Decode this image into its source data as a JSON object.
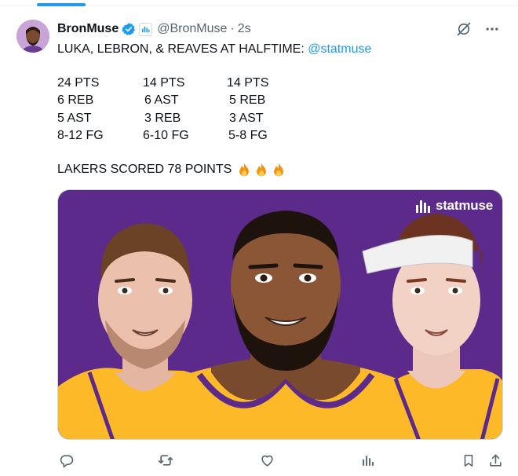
{
  "tweet": {
    "display_name": "BronMuse",
    "handle": "@BronMuse",
    "separator": "·",
    "time": "2s",
    "text_prefix": "LUKA, LEBRON, & REAVES AT HALFTIME: ",
    "mention": "@statmuse",
    "stats": [
      [
        "24 PTS",
        "6 REB",
        "5 AST",
        "8-12 FG"
      ],
      [
        "14 PTS",
        "6 AST",
        "3 REB",
        "6-10 FG"
      ],
      [
        "14 PTS",
        "5 REB",
        "3 AST",
        "5-8 FG"
      ]
    ],
    "scored_text": "LAKERS SCORED 78 POINTS",
    "media": {
      "brand": "statmuse",
      "accent_bg": "#5b2a8a",
      "jersey_color": "#fdb927"
    }
  },
  "header_icons": [
    "grok-icon",
    "more-icon"
  ],
  "actions": [
    "reply-icon",
    "retweet-icon",
    "like-icon",
    "views-icon",
    "bookmark-icon",
    "share-icon"
  ],
  "colors": {
    "accent": "#1d9bf0",
    "muted": "#536471",
    "text": "#0f1419"
  }
}
